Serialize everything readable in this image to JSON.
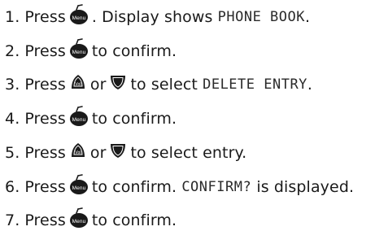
{
  "steps": [
    {
      "num": "1.",
      "parts": [
        {
          "t": "text",
          "v": "Press"
        },
        {
          "t": "icon",
          "icon": "menu-icon",
          "label": "Menu"
        },
        {
          "t": "text",
          "v": ". Display shows "
        },
        {
          "t": "lcd",
          "v": "PHONE BOOK"
        },
        {
          "t": "text",
          "v": "."
        }
      ]
    },
    {
      "num": "2.",
      "parts": [
        {
          "t": "text",
          "v": "Press"
        },
        {
          "t": "icon",
          "icon": "menu-icon",
          "label": "Menu"
        },
        {
          "t": "text",
          "v": "to confirm."
        }
      ]
    },
    {
      "num": "3.",
      "parts": [
        {
          "t": "text",
          "v": "Press"
        },
        {
          "t": "icon",
          "icon": "vol-up-icon",
          "label": "Vol"
        },
        {
          "t": "text",
          "v": "or"
        },
        {
          "t": "icon",
          "icon": "down-arrow-icon",
          "label": ""
        },
        {
          "t": "text",
          "v": "to select "
        },
        {
          "t": "lcd",
          "v": "DELETE ENTRY"
        },
        {
          "t": "text",
          "v": "."
        }
      ]
    },
    {
      "num": "4.",
      "parts": [
        {
          "t": "text",
          "v": "Press"
        },
        {
          "t": "icon",
          "icon": "menu-icon",
          "label": "Menu"
        },
        {
          "t": "text",
          "v": "to confirm."
        }
      ]
    },
    {
      "num": "5.",
      "parts": [
        {
          "t": "text",
          "v": "Press"
        },
        {
          "t": "icon",
          "icon": "vol-up-icon",
          "label": "Vol"
        },
        {
          "t": "text",
          "v": "or"
        },
        {
          "t": "icon",
          "icon": "down-arrow-icon",
          "label": ""
        },
        {
          "t": "text",
          "v": "to select entry."
        }
      ]
    },
    {
      "num": "6.",
      "parts": [
        {
          "t": "text",
          "v": "Press"
        },
        {
          "t": "icon",
          "icon": "menu-icon",
          "label": "Menu"
        },
        {
          "t": "text",
          "v": "to confirm. "
        },
        {
          "t": "lcd",
          "v": "CONFIRM?"
        },
        {
          "t": "text",
          "v": " is displayed."
        }
      ]
    },
    {
      "num": "7.",
      "parts": [
        {
          "t": "text",
          "v": "Press"
        },
        {
          "t": "icon",
          "icon": "menu-icon",
          "label": "Menu"
        },
        {
          "t": "text",
          "v": "to confirm."
        }
      ]
    }
  ]
}
